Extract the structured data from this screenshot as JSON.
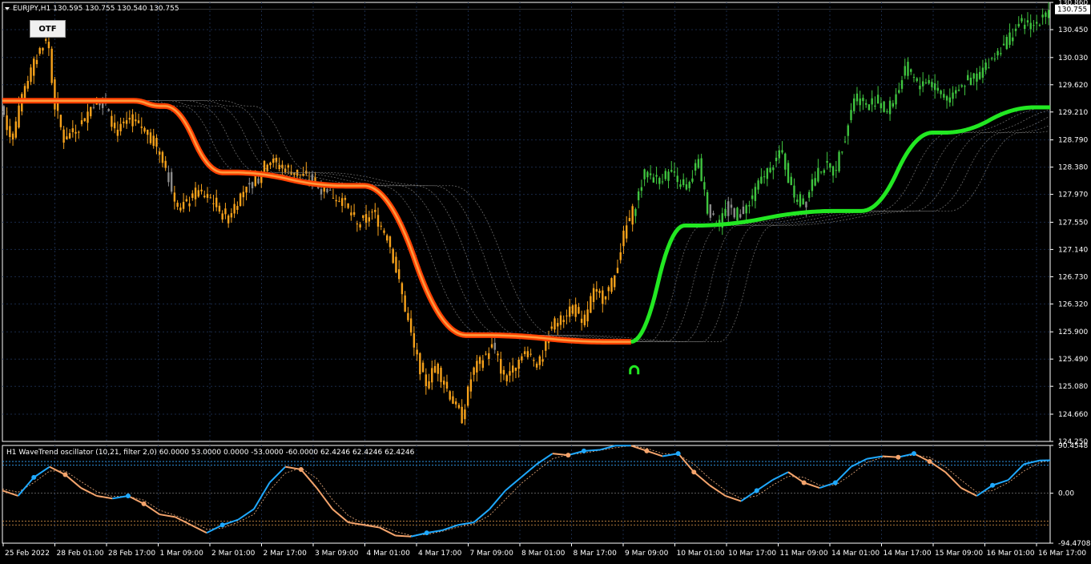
{
  "main_header": "EURJPY,H1  130.595 130.755 130.540 130.755",
  "otf_button": "OTF",
  "current_price": "130.755",
  "osc_header": "H1 WaveTrend oscillator (10,21, filter 2,0) 60.0000 53.0000 0.0000 -53.0000 -60.0000 62.4246 62.4246 62.4246",
  "colors": {
    "bear_candle": "#f7a21b",
    "bull_candle": "#3fc43f",
    "neutral_candle": "#8c8c8c",
    "trail_up": "#22e822",
    "trail_down_outer": "#ff4000",
    "trail_down_inner": "#ff9a3c",
    "wt_up": "#1fa9ff",
    "wt_down": "#f4a46c",
    "frame": "#ffffff",
    "grid": "#1a2a48",
    "level_cyan": "#35a9ff",
    "level_orange": "#e8a050"
  },
  "chart_data": [
    {
      "type": "candlestick",
      "symbol": "EURJPY",
      "timeframe": "H1",
      "ylim": [
        124.25,
        130.86
      ],
      "y_ticks": [
        "130.860",
        "130.450",
        "130.030",
        "129.620",
        "129.210",
        "128.790",
        "128.380",
        "127.970",
        "127.550",
        "127.140",
        "126.730",
        "126.320",
        "125.900",
        "125.490",
        "125.080",
        "124.660",
        "124.250"
      ],
      "x_ticks": [
        "25 Feb 2022",
        "28 Feb 01:00",
        "28 Feb 17:00",
        "1 Mar 09:00",
        "2 Mar 01:00",
        "2 Mar 17:00",
        "3 Mar 09:00",
        "4 Mar 01:00",
        "4 Mar 17:00",
        "7 Mar 09:00",
        "8 Mar 01:00",
        "8 Mar 17:00",
        "9 Mar 09:00",
        "10 Mar 01:00",
        "10 Mar 17:00",
        "11 Mar 09:00",
        "14 Mar 01:00",
        "14 Mar 17:00",
        "15 Mar 09:00",
        "16 Mar 01:00",
        "16 Mar 17:00"
      ],
      "price_path": [
        [
          0,
          129.3
        ],
        [
          0.01,
          128.8
        ],
        [
          0.025,
          129.7
        ],
        [
          0.04,
          130.25
        ],
        [
          0.045,
          130.3
        ],
        [
          0.05,
          129.4
        ],
        [
          0.06,
          128.8
        ],
        [
          0.075,
          129.0
        ],
        [
          0.09,
          129.4
        ],
        [
          0.1,
          129.3
        ],
        [
          0.11,
          128.9
        ],
        [
          0.125,
          129.1
        ],
        [
          0.14,
          128.9
        ],
        [
          0.155,
          128.5
        ],
        [
          0.17,
          127.7
        ],
        [
          0.185,
          128.0
        ],
        [
          0.2,
          127.9
        ],
        [
          0.215,
          127.6
        ],
        [
          0.23,
          128.0
        ],
        [
          0.245,
          128.2
        ],
        [
          0.255,
          128.5
        ],
        [
          0.265,
          128.4
        ],
        [
          0.28,
          128.3
        ],
        [
          0.295,
          128.2
        ],
        [
          0.31,
          128.0
        ],
        [
          0.325,
          127.9
        ],
        [
          0.34,
          127.5
        ],
        [
          0.355,
          127.7
        ],
        [
          0.37,
          127.3
        ],
        [
          0.385,
          126.3
        ],
        [
          0.395,
          125.6
        ],
        [
          0.405,
          125.1
        ],
        [
          0.415,
          125.4
        ],
        [
          0.43,
          124.9
        ],
        [
          0.44,
          124.6
        ],
        [
          0.45,
          125.3
        ],
        [
          0.46,
          125.5
        ],
        [
          0.47,
          125.7
        ],
        [
          0.48,
          125.2
        ],
        [
          0.49,
          125.4
        ],
        [
          0.5,
          125.6
        ],
        [
          0.515,
          125.4
        ],
        [
          0.525,
          126.0
        ],
        [
          0.535,
          126.1
        ],
        [
          0.545,
          126.3
        ],
        [
          0.555,
          126.0
        ],
        [
          0.565,
          126.5
        ],
        [
          0.575,
          126.4
        ],
        [
          0.585,
          126.7
        ],
        [
          0.595,
          127.4
        ],
        [
          0.605,
          127.8
        ],
        [
          0.615,
          128.3
        ],
        [
          0.625,
          128.2
        ],
        [
          0.64,
          128.3
        ],
        [
          0.655,
          128.0
        ],
        [
          0.665,
          128.5
        ],
        [
          0.675,
          127.7
        ],
        [
          0.685,
          127.5
        ],
        [
          0.695,
          127.8
        ],
        [
          0.705,
          127.6
        ],
        [
          0.715,
          127.9
        ],
        [
          0.73,
          128.3
        ],
        [
          0.745,
          128.6
        ],
        [
          0.755,
          128.0
        ],
        [
          0.765,
          127.8
        ],
        [
          0.775,
          128.2
        ],
        [
          0.785,
          128.4
        ],
        [
          0.795,
          128.3
        ],
        [
          0.805,
          128.8
        ],
        [
          0.815,
          129.5
        ],
        [
          0.825,
          129.3
        ],
        [
          0.835,
          129.4
        ],
        [
          0.845,
          129.2
        ],
        [
          0.855,
          129.5
        ],
        [
          0.865,
          129.9
        ],
        [
          0.875,
          129.6
        ],
        [
          0.885,
          129.7
        ],
        [
          0.895,
          129.5
        ],
        [
          0.905,
          129.4
        ],
        [
          0.915,
          129.6
        ],
        [
          0.925,
          129.7
        ],
        [
          0.935,
          129.8
        ],
        [
          0.945,
          130.0
        ],
        [
          0.955,
          130.2
        ],
        [
          0.965,
          130.4
        ],
        [
          0.975,
          130.55
        ],
        [
          0.985,
          130.5
        ],
        [
          1.0,
          130.755
        ]
      ],
      "trailing_stop": [
        {
          "from": 0,
          "to": 0.125,
          "value": 129.38,
          "trend": "down"
        },
        {
          "from": 0.125,
          "to": 0.155,
          "value": 129.3,
          "trend": "down"
        },
        {
          "from": 0.155,
          "to": 0.22,
          "value": 128.3,
          "trend": "down"
        },
        {
          "from": 0.22,
          "to": 0.345,
          "value": 128.1,
          "trend": "down"
        },
        {
          "from": 0.345,
          "to": 0.46,
          "value": 125.85,
          "trend": "down"
        },
        {
          "from": 0.46,
          "to": 0.6,
          "value": 125.75,
          "trend": "down"
        },
        {
          "from": 0.6,
          "to": 0.66,
          "value": 127.5,
          "trend": "up"
        },
        {
          "from": 0.66,
          "to": 0.82,
          "value": 127.72,
          "trend": "up"
        },
        {
          "from": 0.82,
          "to": 0.9,
          "value": 128.9,
          "trend": "up"
        },
        {
          "from": 0.9,
          "to": 1.0,
          "value": 129.28,
          "trend": "up"
        }
      ],
      "signal_marker": {
        "x": 0.603,
        "price": 125.32,
        "type": "buy"
      }
    },
    {
      "type": "line",
      "title": "H1 WaveTrend oscillator (10,21, filter 2,0)",
      "ylim": [
        -94.47,
        90.4
      ],
      "y_ticks": [
        "90.4548",
        "0.00",
        "-94.4708"
      ],
      "levels": [
        60,
        53,
        0,
        -53,
        -60
      ],
      "series": [
        {
          "name": "wt1",
          "values": [
            [
              0,
              5
            ],
            [
              0.015,
              -5
            ],
            [
              0.03,
              30
            ],
            [
              0.045,
              50
            ],
            [
              0.06,
              35
            ],
            [
              0.075,
              10
            ],
            [
              0.09,
              -5
            ],
            [
              0.105,
              -10
            ],
            [
              0.12,
              -5
            ],
            [
              0.135,
              -20
            ],
            [
              0.15,
              -40
            ],
            [
              0.165,
              -45
            ],
            [
              0.18,
              -60
            ],
            [
              0.195,
              -75
            ],
            [
              0.21,
              -60
            ],
            [
              0.225,
              -50
            ],
            [
              0.24,
              -30
            ],
            [
              0.255,
              20
            ],
            [
              0.27,
              50
            ],
            [
              0.285,
              45
            ],
            [
              0.3,
              10
            ],
            [
              0.315,
              -30
            ],
            [
              0.33,
              -55
            ],
            [
              0.345,
              -60
            ],
            [
              0.36,
              -65
            ],
            [
              0.375,
              -80
            ],
            [
              0.39,
              -82
            ],
            [
              0.405,
              -75
            ],
            [
              0.42,
              -70
            ],
            [
              0.435,
              -60
            ],
            [
              0.45,
              -55
            ],
            [
              0.465,
              -30
            ],
            [
              0.48,
              5
            ],
            [
              0.495,
              30
            ],
            [
              0.51,
              55
            ],
            [
              0.525,
              75
            ],
            [
              0.54,
              72
            ],
            [
              0.555,
              80
            ],
            [
              0.57,
              82
            ],
            [
              0.585,
              90
            ],
            [
              0.6,
              90
            ],
            [
              0.615,
              80
            ],
            [
              0.63,
              70
            ],
            [
              0.645,
              75
            ],
            [
              0.66,
              40
            ],
            [
              0.675,
              15
            ],
            [
              0.69,
              -5
            ],
            [
              0.705,
              -15
            ],
            [
              0.72,
              5
            ],
            [
              0.735,
              25
            ],
            [
              0.75,
              40
            ],
            [
              0.765,
              20
            ],
            [
              0.78,
              10
            ],
            [
              0.795,
              20
            ],
            [
              0.81,
              50
            ],
            [
              0.825,
              65
            ],
            [
              0.84,
              70
            ],
            [
              0.855,
              68
            ],
            [
              0.87,
              75
            ],
            [
              0.885,
              60
            ],
            [
              0.9,
              40
            ],
            [
              0.915,
              10
            ],
            [
              0.93,
              -5
            ],
            [
              0.945,
              15
            ],
            [
              0.96,
              25
            ],
            [
              0.975,
              55
            ],
            [
              0.99,
              62
            ],
            [
              1.0,
              62.42
            ]
          ]
        },
        {
          "name": "wt2",
          "values": [
            [
              0,
              8
            ],
            [
              0.015,
              2
            ],
            [
              0.03,
              20
            ],
            [
              0.045,
              42
            ],
            [
              0.06,
              42
            ],
            [
              0.075,
              22
            ],
            [
              0.09,
              3
            ],
            [
              0.105,
              -6
            ],
            [
              0.12,
              -6
            ],
            [
              0.135,
              -13
            ],
            [
              0.15,
              -32
            ],
            [
              0.165,
              -42
            ],
            [
              0.18,
              -52
            ],
            [
              0.195,
              -68
            ],
            [
              0.21,
              -66
            ],
            [
              0.225,
              -55
            ],
            [
              0.24,
              -40
            ],
            [
              0.255,
              5
            ],
            [
              0.27,
              38
            ],
            [
              0.285,
              48
            ],
            [
              0.3,
              28
            ],
            [
              0.315,
              -12
            ],
            [
              0.33,
              -42
            ],
            [
              0.345,
              -58
            ],
            [
              0.36,
              -62
            ],
            [
              0.375,
              -72
            ],
            [
              0.39,
              -80
            ],
            [
              0.405,
              -78
            ],
            [
              0.42,
              -72
            ],
            [
              0.435,
              -64
            ],
            [
              0.45,
              -58
            ],
            [
              0.465,
              -42
            ],
            [
              0.48,
              -12
            ],
            [
              0.495,
              18
            ],
            [
              0.51,
              42
            ],
            [
              0.525,
              65
            ],
            [
              0.54,
              73
            ],
            [
              0.555,
              76
            ],
            [
              0.57,
              81
            ],
            [
              0.585,
              86
            ],
            [
              0.6,
              90
            ],
            [
              0.615,
              85
            ],
            [
              0.63,
              75
            ],
            [
              0.645,
              73
            ],
            [
              0.66,
              55
            ],
            [
              0.675,
              28
            ],
            [
              0.69,
              5
            ],
            [
              0.705,
              -10
            ],
            [
              0.72,
              -5
            ],
            [
              0.735,
              15
            ],
            [
              0.75,
              32
            ],
            [
              0.765,
              30
            ],
            [
              0.78,
              15
            ],
            [
              0.795,
              15
            ],
            [
              0.81,
              35
            ],
            [
              0.825,
              58
            ],
            [
              0.84,
              68
            ],
            [
              0.855,
              69
            ],
            [
              0.87,
              72
            ],
            [
              0.885,
              68
            ],
            [
              0.9,
              50
            ],
            [
              0.915,
              25
            ],
            [
              0.93,
              2
            ],
            [
              0.945,
              5
            ],
            [
              0.96,
              20
            ],
            [
              0.975,
              42
            ],
            [
              0.99,
              58
            ],
            [
              1.0,
              62.42
            ]
          ]
        }
      ]
    }
  ]
}
